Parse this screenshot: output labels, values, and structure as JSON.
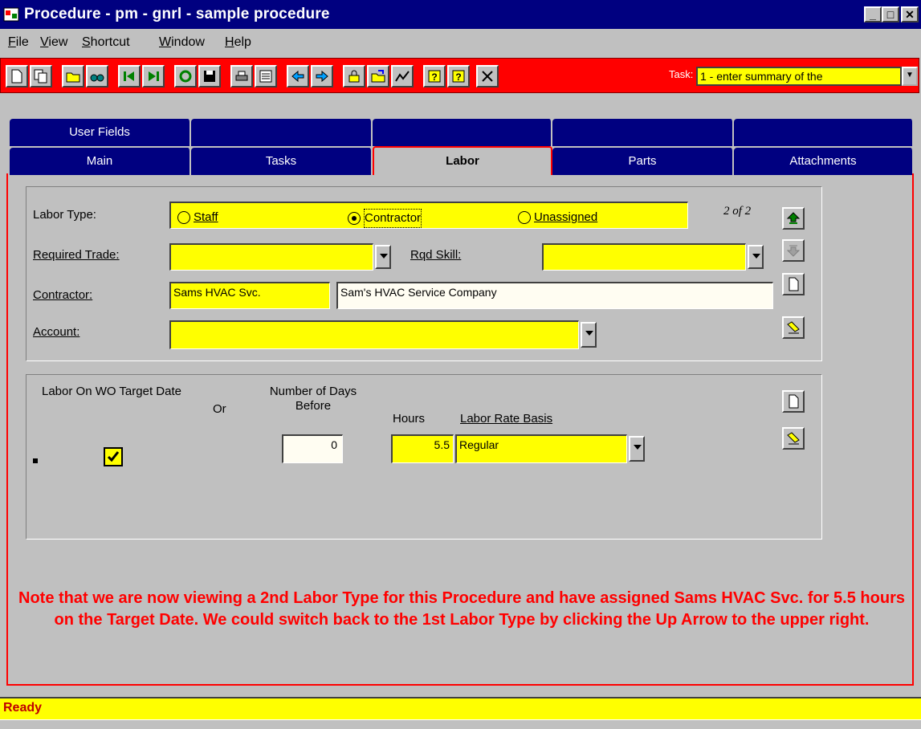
{
  "window": {
    "title": "Procedure - pm - gnrl - sample procedure",
    "controls": [
      "_",
      "□",
      "✕"
    ]
  },
  "menu": [
    {
      "label": "File",
      "key": "F",
      "rest": "ile"
    },
    {
      "label": "View",
      "key": "V",
      "rest": "iew"
    },
    {
      "label": "Shortcut",
      "key": "S",
      "rest": "hortcut"
    },
    {
      "label": "Window",
      "key": "W",
      "rest": "indow"
    },
    {
      "label": "Help",
      "key": "H",
      "rest": "elp"
    }
  ],
  "toolbar": {
    "task_label": "Task:",
    "task_value": "1 - enter summary of the"
  },
  "tabs": {
    "row1": [
      "User Fields",
      "",
      "",
      "",
      ""
    ],
    "row2": [
      "Main",
      "Tasks",
      "Labor",
      "Parts",
      "Attachments"
    ],
    "active": "Labor"
  },
  "labor": {
    "labor_type_label": "Labor Type:",
    "radio_staff": "Staff",
    "radio_contractor": "Contractor",
    "radio_unassigned": "Unassigned",
    "selected_type": "Contractor",
    "record_counter": "2 of 2",
    "required_trade_label": "Required Trade:",
    "required_trade_value": "",
    "rqd_skill_label": "Rqd Skill:",
    "rqd_skill_value": "",
    "contractor_label": "Contractor:",
    "contractor_code": "Sams HVAC Svc.",
    "contractor_name": "Sam's HVAC Service Company",
    "account_label": "Account:",
    "account_value": ""
  },
  "schedule": {
    "col_target_date": "Labor On WO Target Date",
    "col_or": "Or",
    "col_days_before": "Number of Days Before",
    "col_hours": "Hours",
    "col_rate_basis": "Labor Rate Basis",
    "row": {
      "target_date_checked": true,
      "days_before": "0",
      "hours": "5.5",
      "rate_basis": "Regular"
    }
  },
  "note": "Note that we are now viewing a 2nd Labor Type for this Procedure and have assigned Sams HVAC Svc. for 5.5 hours on the Target Date.  We could switch back to the 1st Labor Type by clicking the Up Arrow to the upper right.",
  "status": "Ready",
  "colors": {
    "titlebar": "#000080",
    "toolbar": "#ff0000",
    "field": "#ffff00",
    "note": "#ff0000"
  }
}
